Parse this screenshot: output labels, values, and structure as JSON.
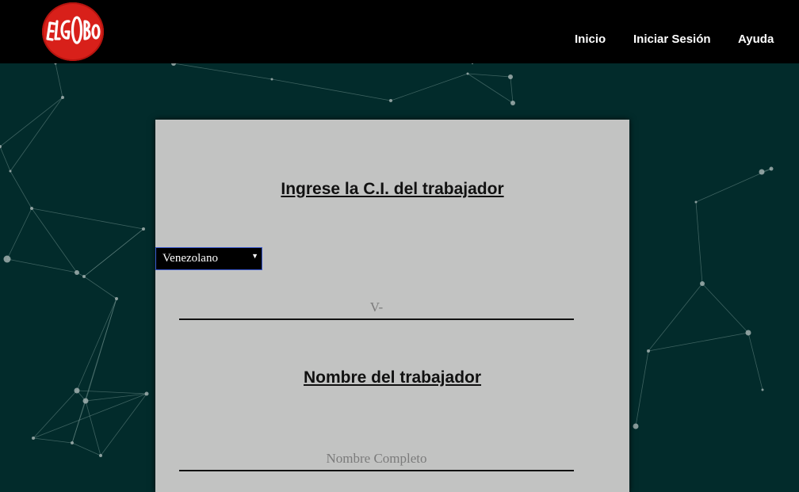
{
  "brand": {
    "logo_text": "ElGlobo",
    "logo_color": "#d8201a"
  },
  "nav": {
    "items": [
      {
        "label": "Inicio"
      },
      {
        "label": "Iniciar Sesión"
      },
      {
        "label": "Ayuda"
      }
    ]
  },
  "form": {
    "ci_title": "Ingrese la C.I. del trabajador",
    "nationality": {
      "selected": "Venezolano"
    },
    "ci_input": {
      "placeholder": "V-",
      "value": ""
    },
    "name_title": "Nombre del trabajador",
    "name_input": {
      "placeholder": "Nombre Completo",
      "value": ""
    }
  },
  "colors": {
    "background": "#022b2b",
    "topbar": "#000000",
    "card": "#c2c3c2",
    "select_border": "#3c5bd1"
  }
}
